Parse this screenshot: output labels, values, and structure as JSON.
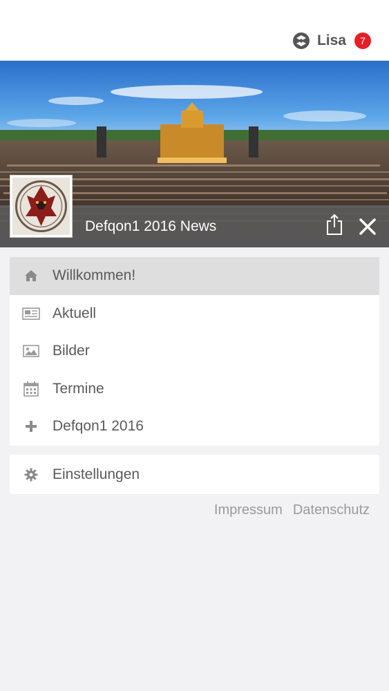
{
  "header": {
    "user_name": "Lisa",
    "notification_count": "7",
    "logo_icon": "app-logo-icon"
  },
  "hero": {
    "title": "Defqon1 2016 News",
    "share_icon": "share-icon",
    "close_icon": "close-icon"
  },
  "menu": {
    "items": [
      {
        "label": "Willkommen!",
        "icon": "home-icon",
        "active": true
      },
      {
        "label": "Aktuell",
        "icon": "newspaper-icon",
        "active": false
      },
      {
        "label": "Bilder",
        "icon": "image-icon",
        "active": false
      },
      {
        "label": "Termine",
        "icon": "calendar-icon",
        "active": false
      },
      {
        "label": "Defqon1 2016",
        "icon": "plus-icon",
        "active": false
      }
    ],
    "settings": {
      "label": "Einstellungen",
      "icon": "gear-icon"
    }
  },
  "footer": {
    "impressum": "Impressum",
    "datenschutz": "Datenschutz"
  },
  "colors": {
    "badge": "#e32027",
    "active_item": "#dedede",
    "hero_bar": "#5a5a5a"
  }
}
